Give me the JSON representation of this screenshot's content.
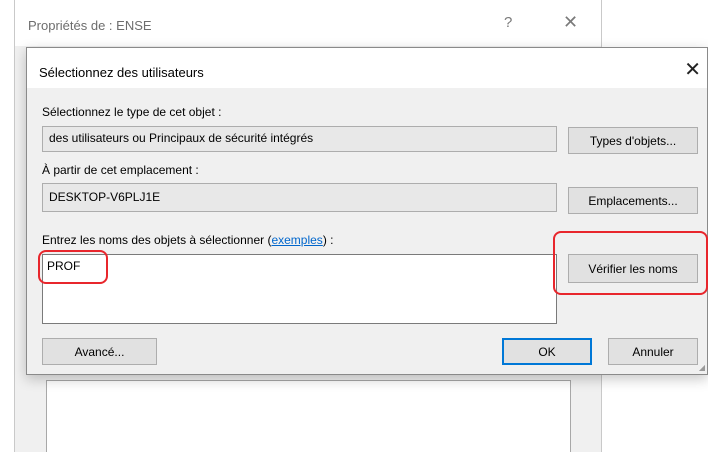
{
  "background_window": {
    "title": "Propriétés de : ENSE",
    "help_glyph": "?",
    "close_glyph": "✕"
  },
  "dialog": {
    "title": "Sélectionnez des utilisateurs",
    "close_glyph": "✕",
    "object_type": {
      "label": "Sélectionnez le type de cet objet :",
      "value": "des utilisateurs ou Principaux de sécurité intégrés",
      "button": "Types d'objets..."
    },
    "location": {
      "label": "À partir de cet emplacement :",
      "value": "DESKTOP-V6PLJ1E",
      "button": "Emplacements..."
    },
    "names": {
      "label_prefix": "Entrez les noms des objets à sélectionner (",
      "link_text": "exemples",
      "label_suffix": ") :",
      "value": "PROF",
      "check_button": "Vérifier les noms"
    },
    "buttons": {
      "advanced": "Avancé...",
      "ok": "OK",
      "cancel": "Annuler"
    }
  },
  "annotation_color": "#e8262c"
}
